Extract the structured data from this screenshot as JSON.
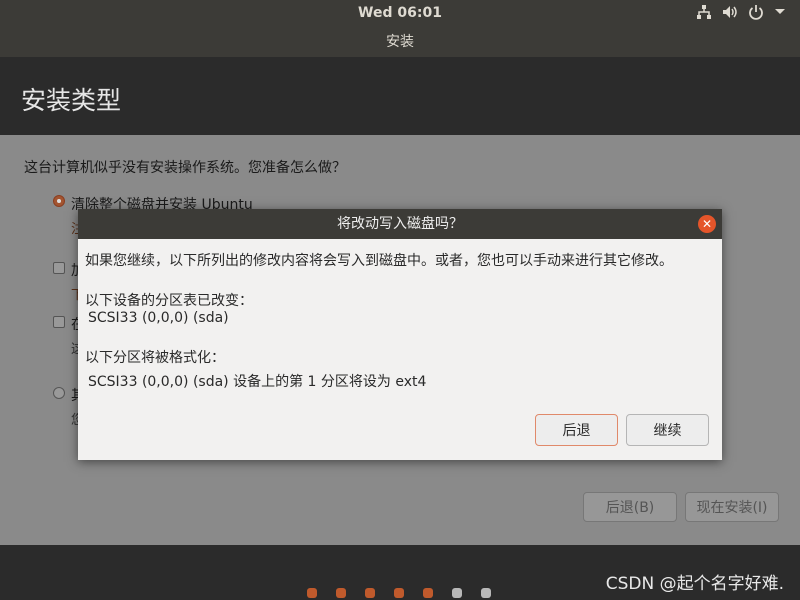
{
  "topbar": {
    "clock": "Wed 06:01",
    "tray_icons": [
      "network-icon",
      "volume-icon",
      "power-icon",
      "chevron-down-icon"
    ]
  },
  "window": {
    "title": "安装"
  },
  "page": {
    "title": "安装类型"
  },
  "main": {
    "question": "这台计算机似乎没有安装操作系统。您准备怎么做？",
    "options": [
      {
        "label": "清除整个磁盘并安装 Ubuntu",
        "sub": "注",
        "selected": true
      },
      {
        "label": "加",
        "sub": "下"
      },
      {
        "label": "在",
        "sub": "这"
      },
      {
        "label": "其",
        "sub": "您"
      }
    ],
    "back_button": "后退(B)",
    "install_button": "现在安装(I)"
  },
  "dialog": {
    "title": "将改动写入磁盘吗？",
    "message": "如果您继续，以下所列出的修改内容将会写入到磁盘中。或者，您也可以手动来进行其它修改。",
    "partition_heading": "以下设备的分区表已改变：",
    "partition_device": "SCSI33 (0,0,0) (sda)",
    "format_heading": "以下分区将被格式化：",
    "format_detail": "SCSI33 (0,0,0) (sda) 设备上的第 1 分区将设为 ext4",
    "back_button": "后退",
    "continue_button": "继续"
  },
  "progress": {
    "total_steps": 7,
    "completed_steps": 5
  },
  "watermark": "CSDN @起个名字好难.",
  "colors": {
    "accent": "#e95420",
    "topbar": "#3c3b37",
    "dimmed": "#8a8a8a"
  }
}
